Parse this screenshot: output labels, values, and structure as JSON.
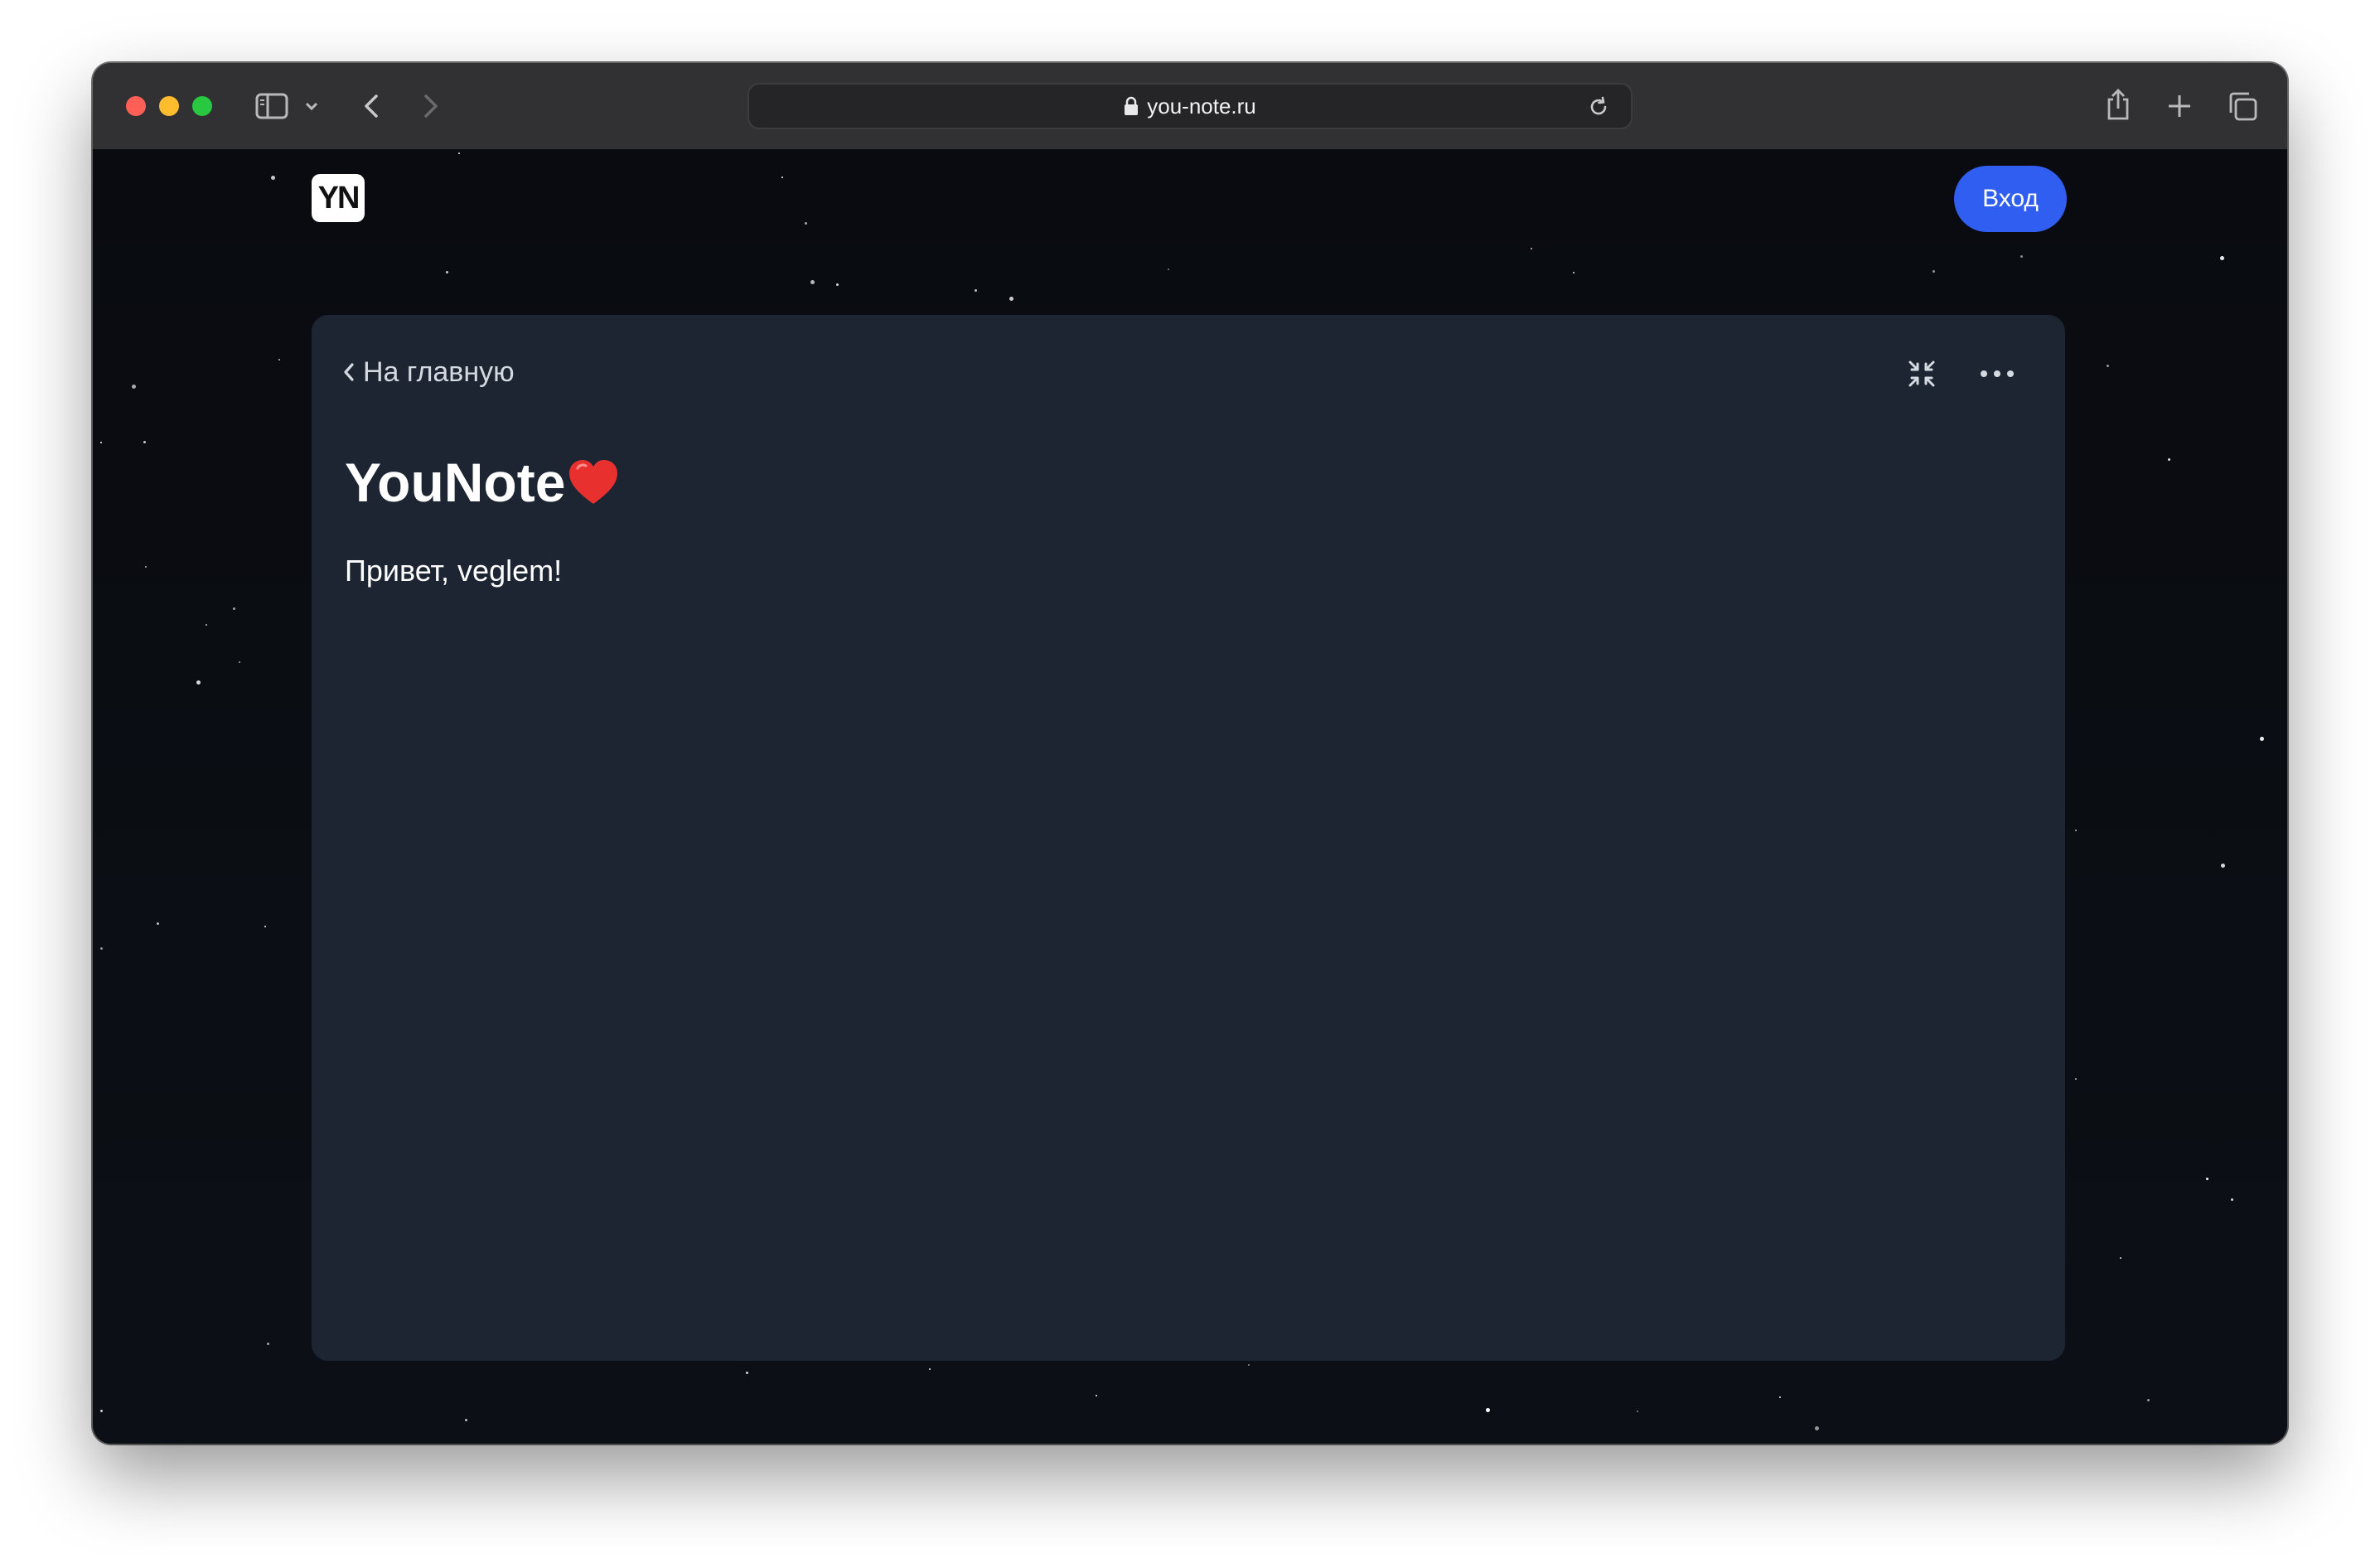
{
  "browser": {
    "url": "you-note.ru"
  },
  "site": {
    "logo_text": "YN",
    "login_label": "Вход"
  },
  "note": {
    "back_label": "На главную",
    "title": "YouNote",
    "title_emoji": "❤️",
    "body": "Привет, veglem!"
  },
  "colors": {
    "accent": "#2f5ef0",
    "card_bg": "#1d2533",
    "page_bg": "#0b0d12"
  },
  "icons": [
    "sidebar-icon",
    "chevron-down-icon",
    "back-arrow-icon",
    "forward-arrow-icon",
    "lock-icon",
    "reload-icon",
    "share-icon",
    "plus-icon",
    "tabs-overview-icon",
    "chevron-left-icon",
    "collapse-icon",
    "more-icon",
    "heart-icon"
  ]
}
